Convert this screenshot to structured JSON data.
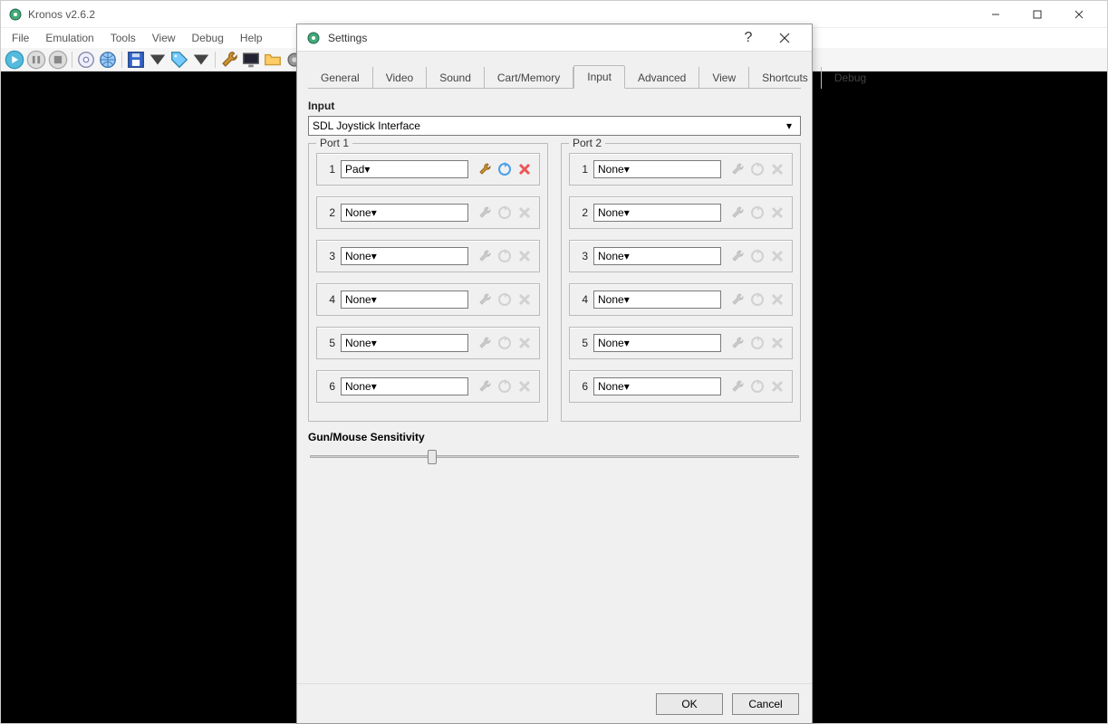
{
  "window": {
    "title": "Kronos v2.6.2"
  },
  "menubar": [
    "File",
    "Emulation",
    "Tools",
    "View",
    "Debug",
    "Help"
  ],
  "dialog": {
    "title": "Settings",
    "tabs": [
      "General",
      "Video",
      "Sound",
      "Cart/Memory",
      "Input",
      "Advanced",
      "View",
      "Shortcuts",
      "Debug"
    ],
    "active_tab": "Input",
    "input": {
      "section_label": "Input",
      "interface_value": "SDL Joystick Interface",
      "port1_label": "Port 1",
      "port2_label": "Port 2",
      "port1_slots": [
        {
          "num": "1",
          "value": "Pad",
          "active": true
        },
        {
          "num": "2",
          "value": "None",
          "active": false
        },
        {
          "num": "3",
          "value": "None",
          "active": false
        },
        {
          "num": "4",
          "value": "None",
          "active": false
        },
        {
          "num": "5",
          "value": "None",
          "active": false
        },
        {
          "num": "6",
          "value": "None",
          "active": false
        }
      ],
      "port2_slots": [
        {
          "num": "1",
          "value": "None",
          "active": false
        },
        {
          "num": "2",
          "value": "None",
          "active": false
        },
        {
          "num": "3",
          "value": "None",
          "active": false
        },
        {
          "num": "4",
          "value": "None",
          "active": false
        },
        {
          "num": "5",
          "value": "None",
          "active": false
        },
        {
          "num": "6",
          "value": "None",
          "active": false
        }
      ],
      "sensitivity_label": "Gun/Mouse Sensitivity"
    },
    "buttons": {
      "ok": "OK",
      "cancel": "Cancel"
    }
  }
}
